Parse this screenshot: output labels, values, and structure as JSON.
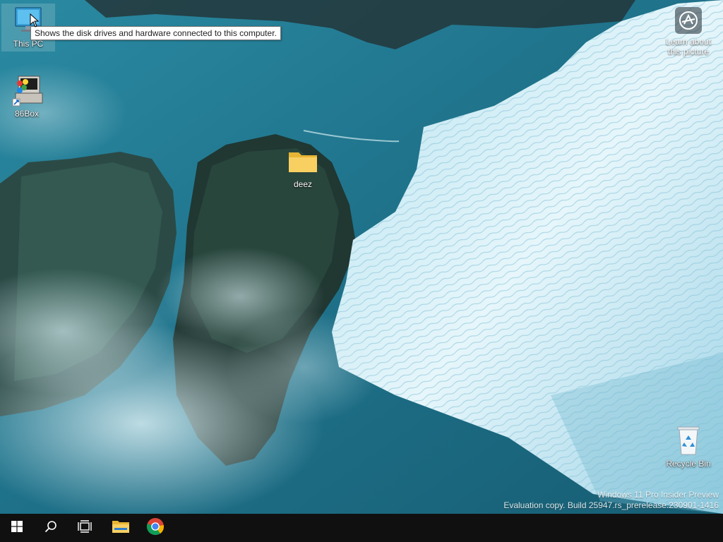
{
  "desktop": {
    "icons": [
      {
        "label": "This PC",
        "icon": "computer-monitor-icon"
      },
      {
        "label": "86Box",
        "icon": "86box-app-icon"
      },
      {
        "label": "deez",
        "icon": "folder-icon"
      },
      {
        "label": "Recycle Bin",
        "icon": "recycle-bin-icon"
      }
    ],
    "tooltip": "Shows the disk drives and hardware connected to this computer.",
    "learn_about": {
      "line1": "Learn about",
      "line2": "this picture",
      "icon": "camera-info-icon"
    }
  },
  "watermark": {
    "line1": "Windows 11 Pro Insider Preview",
    "line2": "Evaluation copy. Build 25947.rs_prerelease.230901-1416"
  },
  "taskbar": {
    "items": [
      {
        "name": "start",
        "icon": "windows-logo-icon"
      },
      {
        "name": "search",
        "icon": "search-icon"
      },
      {
        "name": "task-view",
        "icon": "task-view-icon"
      },
      {
        "name": "file-explorer",
        "icon": "folder-icon"
      },
      {
        "name": "chrome",
        "icon": "chrome-icon"
      }
    ],
    "background": "#101010"
  },
  "colors": {
    "water": "#1f6f86",
    "glacier": "#dff3fa",
    "folder": "#f6c94a",
    "accent": "#76b9ed"
  }
}
